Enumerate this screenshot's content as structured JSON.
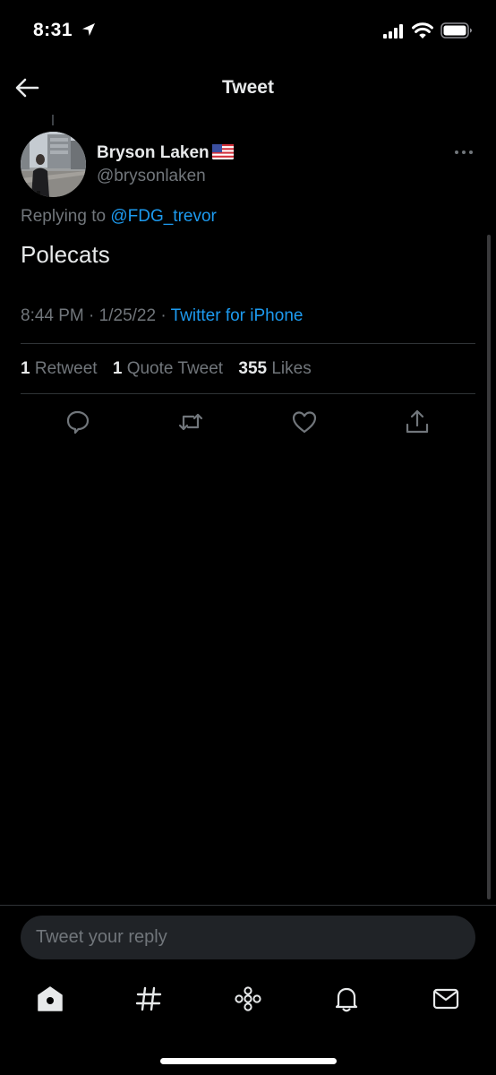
{
  "status_bar": {
    "time": "8:31",
    "icons": [
      "location-arrow-icon",
      "cellular-signal-icon",
      "wifi-icon",
      "battery-icon"
    ]
  },
  "header": {
    "title": "Tweet",
    "back_icon": "back-arrow-icon"
  },
  "tweet": {
    "author_name": "Bryson Laken",
    "author_flag": "us-flag-emoji",
    "author_handle": "@brysonlaken",
    "replying_prefix": "Replying to",
    "replying_to": "@FDG_trevor",
    "text": "Polecats",
    "time": "8:44 PM",
    "date": "1/25/22",
    "source": "Twitter for iPhone",
    "stats": {
      "retweets_count": "1",
      "retweets_label": "Retweet",
      "quotes_count": "1",
      "quotes_label": "Quote Tweet",
      "likes_count": "355",
      "likes_label": "Likes"
    },
    "actions": [
      "reply-icon",
      "retweet-icon",
      "like-icon",
      "share-icon"
    ]
  },
  "reply_box": {
    "placeholder": "Tweet your reply"
  },
  "tab_bar": {
    "tabs": [
      "home-icon",
      "explore-hashtag-icon",
      "spaces-icon",
      "notifications-bell-icon",
      "messages-mail-icon"
    ]
  },
  "colors": {
    "background": "#000000",
    "link": "#1d9bf0",
    "text_primary": "#e7e9ea",
    "text_secondary": "#71767b",
    "divider": "#2f3336",
    "input_bg": "#202327"
  }
}
